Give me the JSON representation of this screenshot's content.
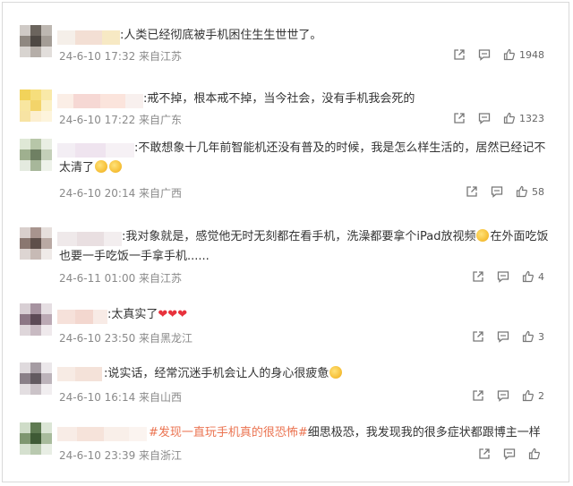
{
  "comments": [
    {
      "text": ":人类已经彻底被手机困住生生世世了。",
      "meta": "24-6-10 17:32 来自江苏",
      "likes": "1948"
    },
    {
      "text": ":戒不掉，根本戒不掉，当今社会，没有手机我会死的",
      "meta": "24-6-10 17:22 来自广东",
      "likes": "1323"
    },
    {
      "text_line1": ":不敢想象十几年前智能机还没有普及的时候，我是怎么样生活的，居然已经记不",
      "text_line2": "太清了",
      "meta": "24-6-10 20:14 来自广西",
      "likes": "58"
    },
    {
      "text_line1_a": ":我对象就是，感觉他无时无刻都在看手机，洗澡都要拿个iPad放视频",
      "text_line1_b": "在外面吃饭",
      "text_line2": "也要一手吃饭一手拿手机......",
      "meta": "24-6-11 01:00 来自江苏",
      "likes": "4"
    },
    {
      "text": ":太真实了",
      "meta": "24-6-10 23:50 来自黑龙江",
      "likes": "3"
    },
    {
      "text": ":说实话，经常沉迷手机会让人的身心很疲惫",
      "meta": "24-6-10 16:14 来自山西",
      "likes": "2"
    },
    {
      "text_hl": "#发现一直玩手机真的很恐怖#",
      "text_rest": "细思极恐，我发现我的很多症状都跟博主一样",
      "meta": "24-6-10 23:39 来自浙江",
      "likes": ""
    }
  ],
  "icons": {
    "share": "share-icon",
    "comment": "comment-icon",
    "like": "thumbs-up-icon"
  },
  "colors": {
    "text": "#333333",
    "meta": "#8a8a8a",
    "topic_link": "#eb7350",
    "heart": "#e8323c"
  }
}
